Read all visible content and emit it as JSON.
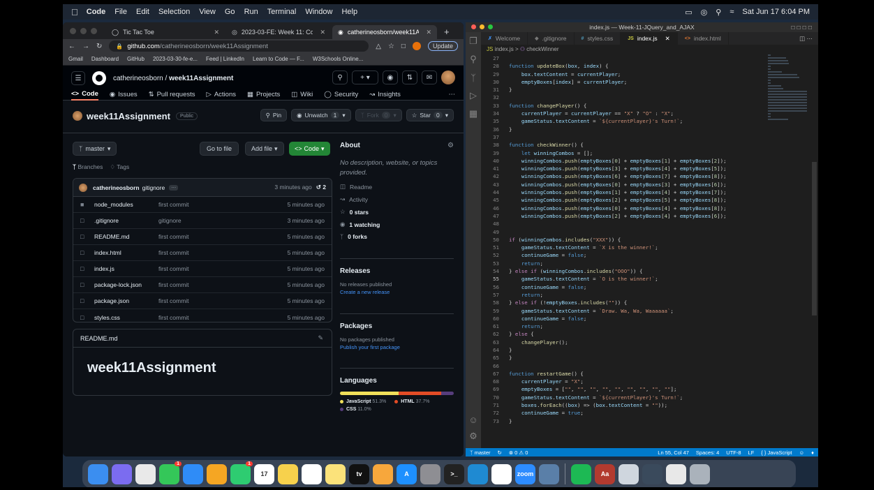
{
  "menubar": {
    "app": "Code",
    "items": [
      "File",
      "Edit",
      "Selection",
      "View",
      "Go",
      "Run",
      "Terminal",
      "Window",
      "Help"
    ],
    "clock": "Sat Jun 17  6:04 PM"
  },
  "chrome": {
    "tabs": [
      {
        "label": "Tic Tac Toe"
      },
      {
        "label": "2023-03-FE: Week 11: Codin"
      },
      {
        "label": "catherineosborn/week11Assig"
      }
    ],
    "url_host": "github.com",
    "url_path": "/catherineosborn/week11Assignment",
    "update_label": "Update",
    "bookmarks": [
      "Gmail",
      "Dashboard",
      "GitHub",
      "2023-03-30-fe-e...",
      "Feed | LinkedIn",
      "Learn to Code — F...",
      "W3Schools Online..."
    ]
  },
  "github": {
    "owner": "catherineosborn",
    "repo": "week11Assignment",
    "nav": [
      "Code",
      "Issues",
      "Pull requests",
      "Actions",
      "Projects",
      "Wiki",
      "Security",
      "Insights"
    ],
    "visibility": "Public",
    "pin_label": "Pin",
    "unwatch_label": "Unwatch",
    "unwatch_count": "1",
    "fork_label": "Fork",
    "fork_count": "0",
    "star_label": "Star",
    "star_count": "0",
    "branch": "master",
    "goto_label": "Go to file",
    "addfile_label": "Add file",
    "code_label": "Code",
    "branches_label": "Branches",
    "tags_label": "Tags",
    "last_commit": {
      "author": "catherineosborn",
      "message": "gitignore",
      "time": "3 minutes ago",
      "count": "2"
    },
    "files": [
      {
        "name": "node_modules",
        "msg": "first commit",
        "time": "5 minutes ago"
      },
      {
        "name": ".gitignore",
        "msg": "gitignore",
        "time": "3 minutes ago"
      },
      {
        "name": "README.md",
        "msg": "first commit",
        "time": "5 minutes ago"
      },
      {
        "name": "index.html",
        "msg": "first commit",
        "time": "5 minutes ago"
      },
      {
        "name": "index.js",
        "msg": "first commit",
        "time": "5 minutes ago"
      },
      {
        "name": "package-lock.json",
        "msg": "first commit",
        "time": "5 minutes ago"
      },
      {
        "name": "package.json",
        "msg": "first commit",
        "time": "5 minutes ago"
      },
      {
        "name": "styles.css",
        "msg": "first commit",
        "time": "5 minutes ago"
      }
    ],
    "readme_title": "README.md",
    "readme_h1": "week11Assignment",
    "about": {
      "title": "About",
      "desc": "No description, website, or topics provided.",
      "readme": "Readme",
      "activity": "Activity",
      "stars": "0 stars",
      "watching": "1 watching",
      "forks": "0 forks"
    },
    "releases": {
      "title": "Releases",
      "text": "No releases published",
      "link": "Create a new release"
    },
    "packages": {
      "title": "Packages",
      "text": "No packages published",
      "link": "Publish your first package"
    },
    "languages": {
      "title": "Languages",
      "items": [
        {
          "name": "JavaScript",
          "pct": "51.3%",
          "color": "#f1e05a",
          "value": 51.3
        },
        {
          "name": "HTML",
          "pct": "37.7%",
          "color": "#e34c26",
          "value": 37.7
        },
        {
          "name": "CSS",
          "pct": "11.0%",
          "color": "#563d7c",
          "value": 11.0
        }
      ]
    }
  },
  "vscode": {
    "title": "index.js — Week-11-JQuery_and_AJAX",
    "tabs": [
      "Welcome",
      ".gitignore",
      "styles.css",
      "index.js",
      "index.html"
    ],
    "crumb_file": "index.js",
    "crumb_symbol": "checkWinner",
    "status": {
      "branch": "master",
      "problems": "⊗ 0 ⚠ 0",
      "position": "Ln 55, Col 47",
      "spaces": "Spaces: 4",
      "encoding": "UTF-8",
      "eol": "LF",
      "lang": "{ } JavaScript"
    },
    "lines": [
      {
        "n": "27",
        "t": ""
      },
      {
        "n": "28",
        "t": "function updateBox(box, index) {"
      },
      {
        "n": "29",
        "t": "    box.textContent = currentPlayer;"
      },
      {
        "n": "30",
        "t": "    emptyBoxes[index] = currentPlayer;"
      },
      {
        "n": "31",
        "t": "}"
      },
      {
        "n": "32",
        "t": ""
      },
      {
        "n": "33",
        "t": "function changePlayer() {"
      },
      {
        "n": "34",
        "t": "    currentPlayer = currentPlayer == \"X\" ? \"O\" : \"X\";"
      },
      {
        "n": "35",
        "t": "    gameStatus.textContent = `${currentPlayer}'s Turn!`;"
      },
      {
        "n": "36",
        "t": "}"
      },
      {
        "n": "37",
        "t": ""
      },
      {
        "n": "38",
        "t": "function checkWinner() {"
      },
      {
        "n": "39",
        "t": "    let winningCombos = [];"
      },
      {
        "n": "40",
        "t": "    winningCombos.push(emptyBoxes[0] + emptyBoxes[1] + emptyBoxes[2]);"
      },
      {
        "n": "41",
        "t": "    winningCombos.push(emptyBoxes[3] + emptyBoxes[4] + emptyBoxes[5]);"
      },
      {
        "n": "42",
        "t": "    winningCombos.push(emptyBoxes[6] + emptyBoxes[7] + emptyBoxes[8]);"
      },
      {
        "n": "43",
        "t": "    winningCombos.push(emptyBoxes[0] + emptyBoxes[3] + emptyBoxes[6]);"
      },
      {
        "n": "44",
        "t": "    winningCombos.push(emptyBoxes[1] + emptyBoxes[4] + emptyBoxes[7]);"
      },
      {
        "n": "45",
        "t": "    winningCombos.push(emptyBoxes[2] + emptyBoxes[5] + emptyBoxes[8]);"
      },
      {
        "n": "46",
        "t": "    winningCombos.push(emptyBoxes[0] + emptyBoxes[4] + emptyBoxes[8]);"
      },
      {
        "n": "47",
        "t": "    winningCombos.push(emptyBoxes[2] + emptyBoxes[4] + emptyBoxes[6]);"
      },
      {
        "n": "48",
        "t": ""
      },
      {
        "n": "49",
        "t": ""
      },
      {
        "n": "50",
        "t": "if (winningCombos.includes(\"XXX\")) {"
      },
      {
        "n": "51",
        "t": "    gameStatus.textContent = `X is the winner!`;"
      },
      {
        "n": "52",
        "t": "    continueGame = false;"
      },
      {
        "n": "53",
        "t": "    return;"
      },
      {
        "n": "54",
        "t": "} else if (winningCombos.includes(\"OOO\")) {"
      },
      {
        "n": "55",
        "t": "    gameStatus.textContent = `O is the winner!`;"
      },
      {
        "n": "56",
        "t": "    continueGame = false;"
      },
      {
        "n": "57",
        "t": "    return;"
      },
      {
        "n": "58",
        "t": "} else if (!emptyBoxes.includes(\"\")) {"
      },
      {
        "n": "59",
        "t": "    gameStatus.textContent = `Draw. Wa, Wa, Waaaaaa`;"
      },
      {
        "n": "60",
        "t": "    continueGame = false;"
      },
      {
        "n": "61",
        "t": "    return;"
      },
      {
        "n": "62",
        "t": "} else {"
      },
      {
        "n": "63",
        "t": "    changePlayer();"
      },
      {
        "n": "64",
        "t": "}"
      },
      {
        "n": "65",
        "t": "}"
      },
      {
        "n": "66",
        "t": ""
      },
      {
        "n": "67",
        "t": "function restartGame() {"
      },
      {
        "n": "68",
        "t": "    currentPlayer = \"X\";"
      },
      {
        "n": "69",
        "t": "    emptyBoxes = [\"\", \"\", \"\", \"\", \"\", \"\", \"\", \"\", \"\"];"
      },
      {
        "n": "70",
        "t": "    gameStatus.textContent = `${currentPlayer}'s Turn!`;"
      },
      {
        "n": "71",
        "t": "    boxes.forEach((box) => (box.textContent = \"\"));"
      },
      {
        "n": "72",
        "t": "    continueGame = true;"
      },
      {
        "n": "73",
        "t": "}"
      }
    ]
  },
  "dock": {
    "apps": [
      {
        "name": "finder",
        "color": "#3b8ef0",
        "label": ""
      },
      {
        "name": "launchpad",
        "color": "#7b6cf0",
        "label": ""
      },
      {
        "name": "chrome",
        "color": "#e9e9e9",
        "label": ""
      },
      {
        "name": "messages",
        "color": "#34c759",
        "label": "",
        "badge": "1"
      },
      {
        "name": "mail",
        "color": "#2f8cf7",
        "label": ""
      },
      {
        "name": "photos",
        "color": "#f5a623",
        "label": ""
      },
      {
        "name": "facetime",
        "color": "#2ecc71",
        "label": "",
        "badge": "1"
      },
      {
        "name": "calendar",
        "color": "#ffffff",
        "label": "17"
      },
      {
        "name": "notes-yellow",
        "color": "#f7d14c",
        "label": ""
      },
      {
        "name": "reminders",
        "color": "#ffffff",
        "label": ""
      },
      {
        "name": "notes",
        "color": "#fbe27a",
        "label": ""
      },
      {
        "name": "appletv",
        "color": "#111111",
        "label": "tv"
      },
      {
        "name": "pages",
        "color": "#f7a73c",
        "label": ""
      },
      {
        "name": "appstore",
        "color": "#1e90ff",
        "label": "A"
      },
      {
        "name": "settings",
        "color": "#8e8e93",
        "label": ""
      },
      {
        "name": "terminal",
        "color": "#222222",
        "label": ">_"
      },
      {
        "name": "vscode",
        "color": "#1f8ad2",
        "label": ""
      },
      {
        "name": "slack",
        "color": "#ffffff",
        "label": ""
      },
      {
        "name": "zoom",
        "color": "#2d8cff",
        "label": "zoom"
      },
      {
        "name": "preview",
        "color": "#5a7fa8",
        "label": ""
      },
      {
        "name": "spotify",
        "color": "#1db954",
        "label": ""
      },
      {
        "name": "dictionary",
        "color": "#b23a2f",
        "label": "Aa"
      },
      {
        "name": "files-1",
        "color": "#cfd6de",
        "label": ""
      },
      {
        "name": "files-2",
        "color": "#3a4a5c",
        "label": ""
      },
      {
        "name": "files-3",
        "color": "#e8e8e8",
        "label": ""
      },
      {
        "name": "trash",
        "color": "#aab2bb",
        "label": ""
      }
    ]
  }
}
